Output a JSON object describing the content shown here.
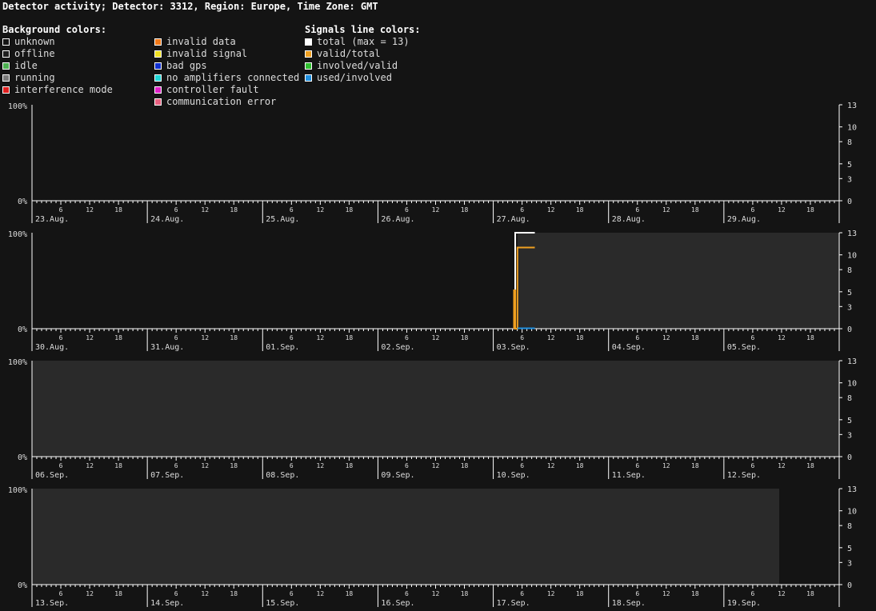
{
  "title": "Detector activity; Detector: 3312, Region: Europe, Time Zone: GMT",
  "legend": {
    "background": {
      "heading": "Background colors:",
      "items": [
        {
          "label": "unknown",
          "color": "#141414"
        },
        {
          "label": "offline",
          "color": "#1e1e1e"
        },
        {
          "label": "idle",
          "color": "#4caf50"
        },
        {
          "label": "running",
          "color": "#7a7a7a"
        },
        {
          "label": "interference mode",
          "color": "#e02020"
        }
      ]
    },
    "errors": {
      "items": [
        {
          "label": "invalid data",
          "color": "#f07818"
        },
        {
          "label": "invalid signal",
          "color": "#f0e020"
        },
        {
          "label": "bad gps",
          "color": "#1030d0"
        },
        {
          "label": "no amplifiers connected",
          "color": "#20d8d8"
        },
        {
          "label": "controller fault",
          "color": "#e020c8"
        },
        {
          "label": "communication error",
          "color": "#e86080"
        }
      ]
    },
    "signals": {
      "heading": "Signals line colors:",
      "items": [
        {
          "label": "total (max = 13)",
          "color": "#ffffff"
        },
        {
          "label": "valid/total",
          "color": "#f0a020"
        },
        {
          "label": "involved/valid",
          "color": "#30c030"
        },
        {
          "label": "used/involved",
          "color": "#2090e0"
        }
      ]
    }
  },
  "axis": {
    "left_top": "100%",
    "left_bottom": "0%",
    "right_ticks": [
      "0",
      "3",
      "5",
      "8",
      "10",
      "13"
    ],
    "hour_ticks": [
      "6",
      "12",
      "18"
    ]
  },
  "chart_data": {
    "type": "line",
    "y_left_range": [
      0,
      100
    ],
    "y_right_range": [
      0,
      13
    ],
    "x_unit": "day",
    "background_colors": {
      "running": "#2a2a2a"
    },
    "rows": [
      {
        "days": [
          "23.Aug.",
          "24.Aug.",
          "25.Aug.",
          "26.Aug.",
          "27.Aug.",
          "28.Aug.",
          "29.Aug."
        ],
        "running_spans": [],
        "series": []
      },
      {
        "days": [
          "30.Aug.",
          "31.Aug.",
          "01.Sep.",
          "02.Sep.",
          "03.Sep.",
          "04.Sep.",
          "05.Sep."
        ],
        "running_spans": [
          [
            4.21,
            7.0
          ]
        ],
        "series": [
          {
            "key": "total",
            "color": "#ffffff",
            "points": [
              [
                4.19,
                0
              ],
              [
                4.19,
                13
              ],
              [
                4.36,
                13
              ]
            ]
          },
          {
            "key": "valid_total",
            "color": "#f0a020",
            "points": [
              [
                4.18,
                0
              ],
              [
                4.18,
                5.2
              ],
              [
                4.19,
                5.2
              ],
              [
                4.19,
                0
              ],
              [
                4.21,
                0
              ],
              [
                4.21,
                11
              ],
              [
                4.36,
                11
              ]
            ]
          },
          {
            "key": "used_involved",
            "color": "#2090e0",
            "points": [
              [
                4.21,
                0.05
              ],
              [
                4.36,
                0.05
              ]
            ]
          }
        ]
      },
      {
        "days": [
          "06.Sep.",
          "07.Sep.",
          "08.Sep.",
          "09.Sep.",
          "10.Sep.",
          "11.Sep.",
          "12.Sep."
        ],
        "running_spans": [
          [
            0.0,
            7.0
          ]
        ],
        "series": []
      },
      {
        "days": [
          "13.Sep.",
          "14.Sep.",
          "15.Sep.",
          "16.Sep.",
          "17.Sep.",
          "18.Sep.",
          "19.Sep."
        ],
        "running_spans": [
          [
            0.0,
            6.48
          ]
        ],
        "series": []
      }
    ]
  }
}
